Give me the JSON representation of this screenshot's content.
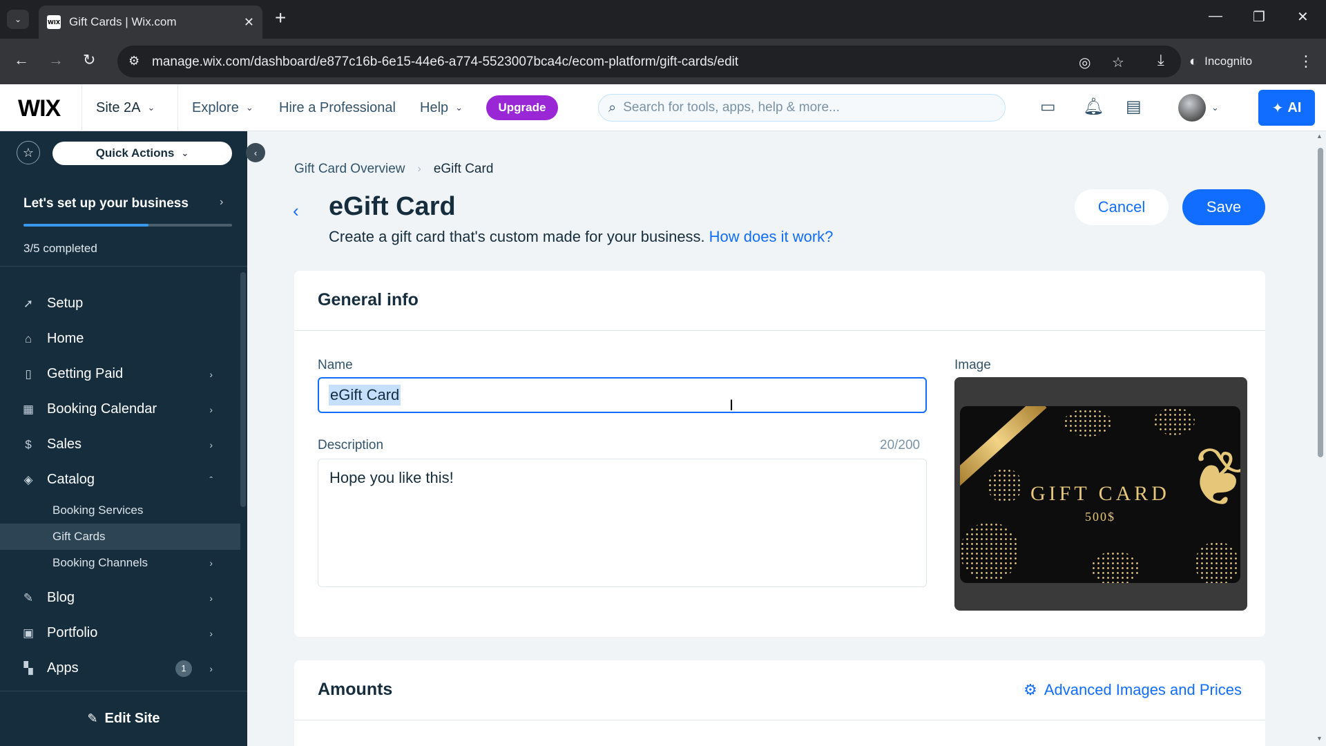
{
  "browser": {
    "tab_title": "Gift Cards | Wix.com",
    "tab_favicon": "WIX",
    "url": "manage.wix.com/dashboard/e877c16b-6e15-44e6-a774-5523007bca4c/ecom-platform/gift-cards/edit",
    "incognito_label": "Incognito"
  },
  "header": {
    "logo": "WIX",
    "site_name": "Site 2A",
    "explore": "Explore",
    "hire": "Hire a Professional",
    "help": "Help",
    "upgrade": "Upgrade",
    "search_placeholder": "Search for tools, apps, help & more...",
    "ai_label": "AI"
  },
  "sidebar": {
    "quick_actions": "Quick Actions",
    "setup_title": "Let's set up your business",
    "setup_progress": 0.6,
    "setup_count": "3/5 completed",
    "items": [
      {
        "label": "Setup",
        "icon": "rocket-icon"
      },
      {
        "label": "Home",
        "icon": "home-icon"
      },
      {
        "label": "Getting Paid",
        "icon": "invoice-icon"
      },
      {
        "label": "Booking Calendar",
        "icon": "calendar-icon"
      },
      {
        "label": "Sales",
        "icon": "dollar-icon"
      },
      {
        "label": "Catalog",
        "icon": "catalog-icon"
      }
    ],
    "catalog_sub": [
      "Booking Services",
      "Gift Cards",
      "Booking Channels"
    ],
    "items_after": [
      {
        "label": "Blog",
        "icon": "pen-icon"
      },
      {
        "label": "Portfolio",
        "icon": "portfolio-icon"
      },
      {
        "label": "Apps",
        "icon": "apps-icon",
        "badge": "1"
      }
    ],
    "edit_site": "Edit Site"
  },
  "main": {
    "breadcrumb": [
      "Gift Card Overview",
      "eGift Card"
    ],
    "title": "eGift Card",
    "subtitle": "Create a gift card that's custom made for your business.",
    "subtitle_link": "How does it work?",
    "cancel": "Cancel",
    "save": "Save",
    "general": {
      "title": "General info",
      "name_label": "Name",
      "name_value": "eGift Card",
      "description_label": "Description",
      "description_value": "Hope you like this!",
      "description_counter": "20/200",
      "image_label": "Image",
      "image_text": "GIFT CARD",
      "image_amount": "500$"
    },
    "amounts": {
      "title": "Amounts",
      "advanced_link": "Advanced Images and Prices"
    }
  },
  "colors": {
    "accent": "#116dff",
    "upgrade": "#9a27d5",
    "sidebar": "#162d3d"
  }
}
